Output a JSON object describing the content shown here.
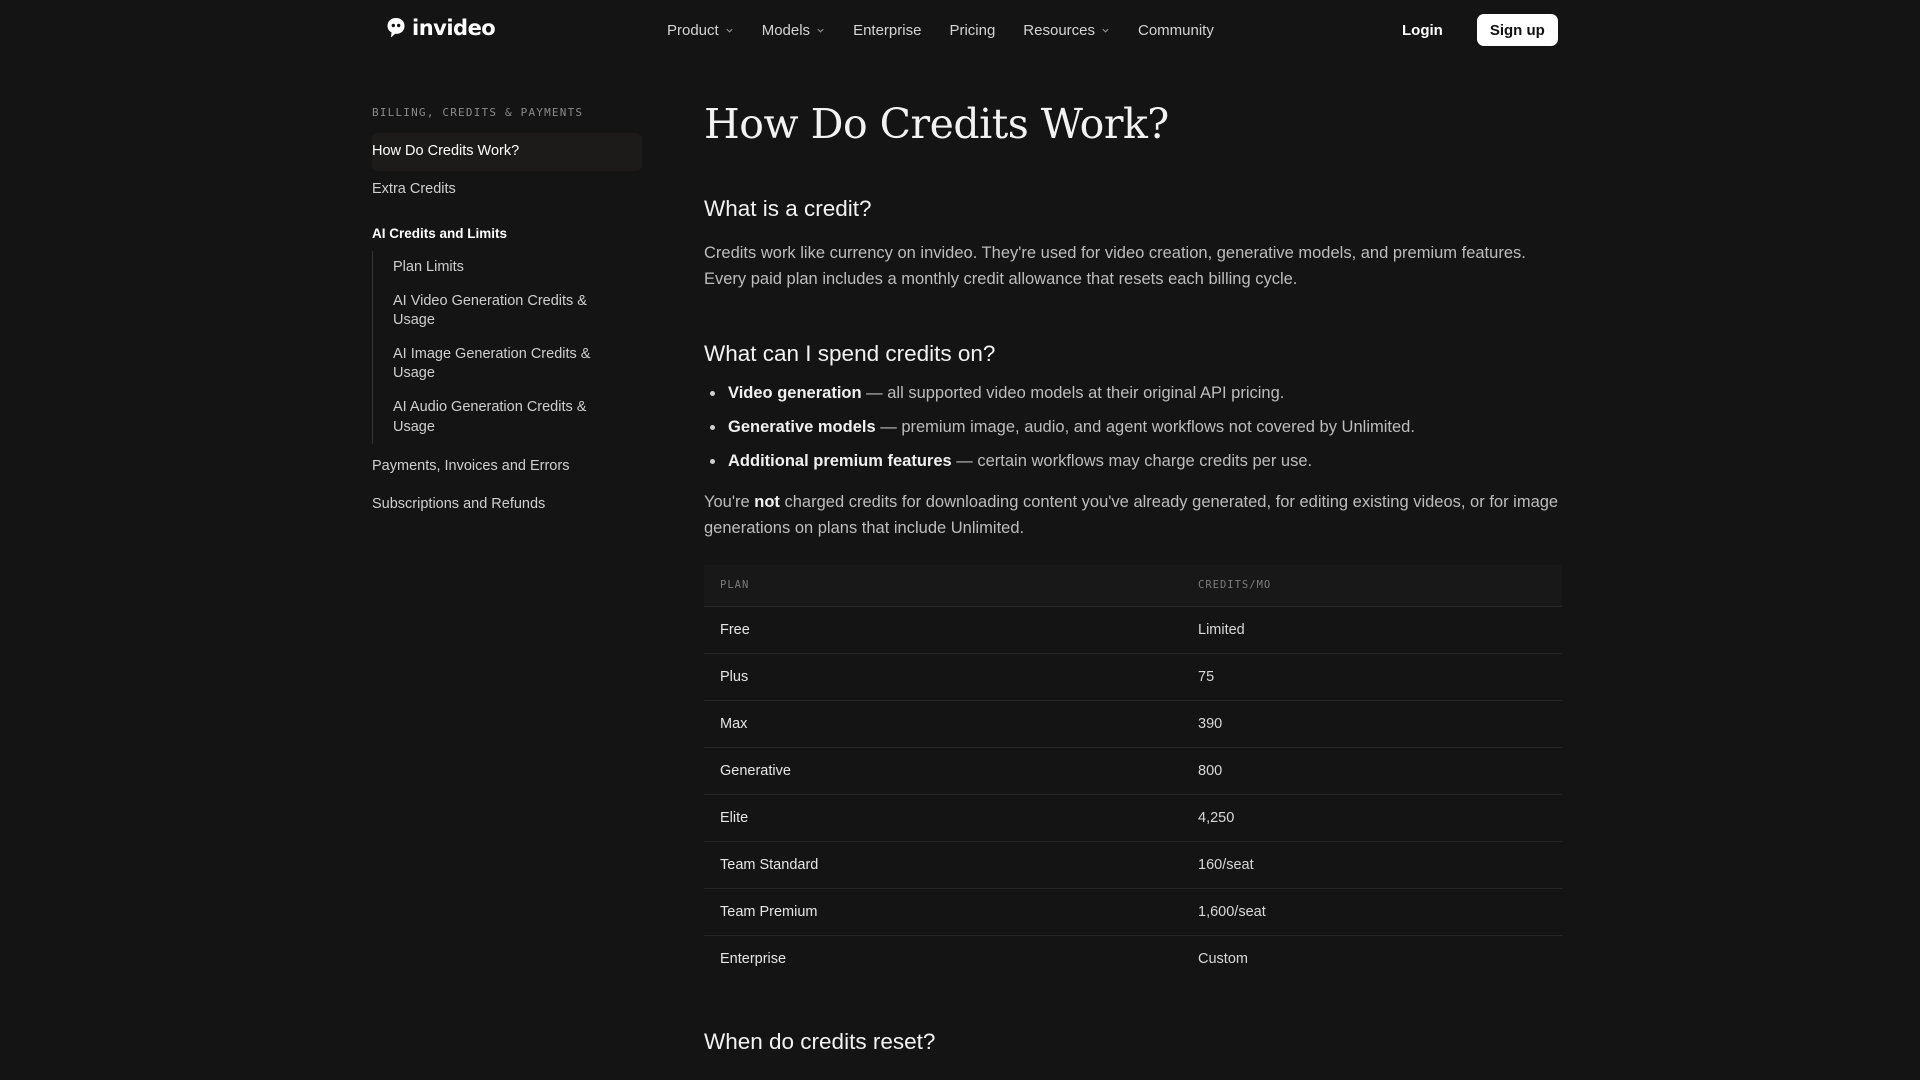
{
  "brand": {
    "name": "invideo"
  },
  "nav": {
    "items": [
      {
        "label": "Product",
        "dropdown": true
      },
      {
        "label": "Models",
        "dropdown": true
      },
      {
        "label": "Enterprise",
        "dropdown": false
      },
      {
        "label": "Pricing",
        "dropdown": false
      },
      {
        "label": "Resources",
        "dropdown": true
      },
      {
        "label": "Community",
        "dropdown": false
      }
    ],
    "login": "Login",
    "signup": "Sign up"
  },
  "sidebar": {
    "section_label": "BILLING, CREDITS & PAYMENTS",
    "items": [
      {
        "label": "How Do Credits Work?",
        "active": true
      },
      {
        "label": "Extra Credits"
      }
    ],
    "group_title": "AI Credits and Limits",
    "group_items": [
      {
        "label": "Plan Limits"
      },
      {
        "label": "AI Video Generation Credits & Usage"
      },
      {
        "label": "AI Image Generation Credits & Usage"
      },
      {
        "label": "AI Audio Generation Credits & Usage"
      }
    ],
    "after_items": [
      {
        "label": "Payments, Invoices and Errors"
      },
      {
        "label": "Subscriptions and Refunds"
      }
    ]
  },
  "article": {
    "title": "How Do Credits Work?",
    "s1_heading": "What is a credit?",
    "s1_body": "Credits work like currency on invideo. They're used for video creation, generative models, and premium features. Every paid plan includes a monthly credit allowance that resets each billing cycle.",
    "s2_heading": "What can I spend credits on?",
    "bullets": [
      {
        "strong": "Video generation",
        "rest": " — all supported video models at their original API pricing."
      },
      {
        "strong": "Generative models",
        "rest": " — premium image, audio, and agent workflows not covered by Unlimited."
      },
      {
        "strong": "Additional premium features",
        "rest": " — certain workflows may charge credits per use."
      }
    ],
    "not_charged_pre": "You're ",
    "not_charged_strong": "not",
    "not_charged_post": " charged credits for downloading content you've already generated, for editing existing videos, or for image generations on plans that include Unlimited.",
    "table": {
      "headers": [
        "PLAN",
        "CREDITS/MO"
      ],
      "rows": [
        [
          "Free",
          "Limited"
        ],
        [
          "Plus",
          "75"
        ],
        [
          "Max",
          "390"
        ],
        [
          "Generative",
          "800"
        ],
        [
          "Elite",
          "4,250"
        ],
        [
          "Team Standard",
          "160/seat"
        ],
        [
          "Team Premium",
          "1,600/seat"
        ],
        [
          "Enterprise",
          "Custom"
        ]
      ]
    },
    "s3_heading": "When do credits reset?"
  }
}
